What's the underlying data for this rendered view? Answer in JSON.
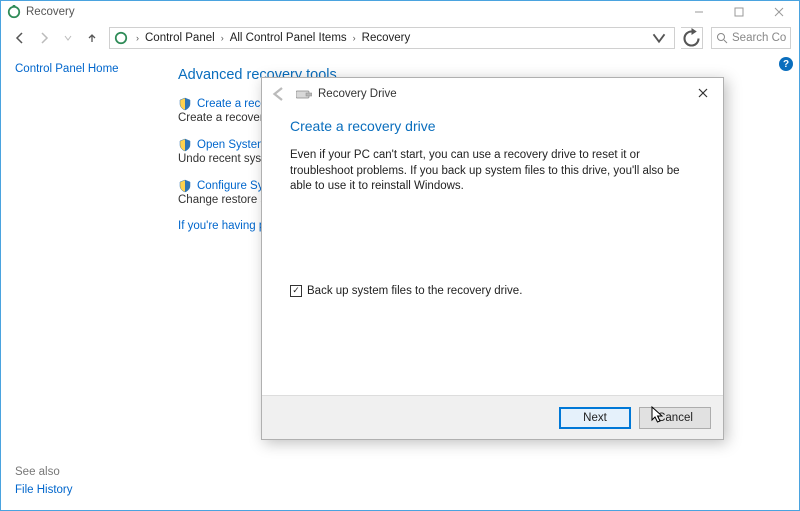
{
  "window_title": "Recovery",
  "breadcrumbs": {
    "item0": "Control Panel",
    "item1": "All Control Panel Items",
    "item2": "Recovery"
  },
  "search": {
    "placeholder": "Search Co..."
  },
  "sidebar": {
    "home": "Control Panel Home"
  },
  "main": {
    "heading": "Advanced recovery tools",
    "tools": {
      "t0": {
        "title": "Create a recovery drive",
        "desc": "Create a recovery drive to troubleshoot problems when your PC can't start."
      },
      "t1": {
        "title": "Open System Restore",
        "desc": "Undo recent system changes, but leave files such as documents, pictures, and music unchanged."
      },
      "t2": {
        "title": "Configure System Restore",
        "desc": "Change restore settings, manage disk space, and create or delete restore points."
      }
    },
    "trouble_link": "If you're having problems with your PC, you can refresh it in PC settings."
  },
  "see_also": {
    "label": "See also",
    "link": "File History"
  },
  "dialog": {
    "header_text": "Recovery Drive",
    "title": "Create a recovery drive",
    "description": "Even if your PC can't start, you can use a recovery drive to reset it or troubleshoot problems. If you back up system files to this drive, you'll also be able to use it to reinstall Windows.",
    "checkbox_label": "Back up system files to the recovery drive.",
    "checkbox_checked": true,
    "next": "Next",
    "cancel": "Cancel"
  }
}
